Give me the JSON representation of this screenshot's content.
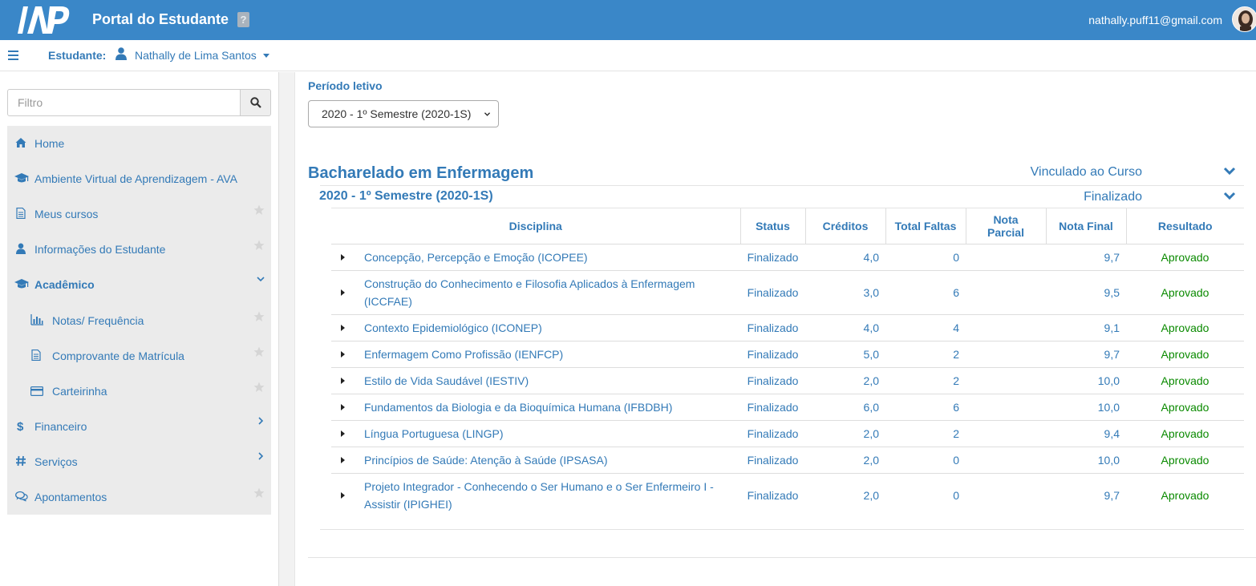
{
  "header": {
    "title": "Portal do Estudante",
    "help": "?",
    "email": "nathally.puff11@gmail.com"
  },
  "studentbar": {
    "label": "Estudante:",
    "name": "Nathally de Lima Santos"
  },
  "sidebar": {
    "filter_placeholder": "Filtro",
    "items": [
      {
        "label": "Home",
        "icon": "home-icon"
      },
      {
        "label": "Ambiente Virtual de Aprendizagem - AVA",
        "icon": "graduation-cap-icon"
      },
      {
        "label": "Meus cursos",
        "icon": "document-icon"
      },
      {
        "label": "Informações do Estudante",
        "icon": "user-icon"
      },
      {
        "label": "Acadêmico",
        "icon": "graduation-cap-icon"
      },
      {
        "label": "Notas/ Frequência",
        "icon": "bar-chart-icon"
      },
      {
        "label": "Comprovante de Matrícula",
        "icon": "document-icon"
      },
      {
        "label": "Carteirinha",
        "icon": "credit-card-icon"
      },
      {
        "label": "Financeiro",
        "icon": "dollar-icon"
      },
      {
        "label": "Serviços",
        "icon": "hash-icon"
      },
      {
        "label": "Apontamentos",
        "icon": "comments-icon"
      }
    ]
  },
  "main": {
    "periodo_label": "Período letivo",
    "periodo_selected": "2020 - 1º Semestre (2020-1S)",
    "course_title": "Bacharelado em Enfermagem",
    "course_status": "Vinculado ao Curso",
    "semester_title": "2020 - 1º Semestre (2020-1S)",
    "semester_status": "Finalizado",
    "table": {
      "headers": {
        "disciplina": "Disciplina",
        "status": "Status",
        "creditos": "Créditos",
        "faltas": "Total Faltas",
        "parcial_1": "Nota",
        "parcial_2": "Parcial",
        "final": "Nota Final",
        "resultado": "Resultado"
      },
      "rows": [
        {
          "disc1": "Concepção, Percepção e Emoção (ICOPEE)",
          "disc2": "",
          "status": "Finalizado",
          "creditos": "4,0",
          "faltas": "0",
          "parcial": "",
          "final": "9,7",
          "resultado": "Aprovado"
        },
        {
          "disc1": "Construção do Conhecimento e Filosofia Aplicados à Enfermagem",
          "disc2": "(ICCFAE)",
          "status": "Finalizado",
          "creditos": "3,0",
          "faltas": "6",
          "parcial": "",
          "final": "9,5",
          "resultado": "Aprovado"
        },
        {
          "disc1": "Contexto Epidemiológico (ICONEP)",
          "disc2": "",
          "status": "Finalizado",
          "creditos": "4,0",
          "faltas": "4",
          "parcial": "",
          "final": "9,1",
          "resultado": "Aprovado"
        },
        {
          "disc1": "Enfermagem Como Profissão (IENFCP)",
          "disc2": "",
          "status": "Finalizado",
          "creditos": "5,0",
          "faltas": "2",
          "parcial": "",
          "final": "9,7",
          "resultado": "Aprovado"
        },
        {
          "disc1": "Estilo de Vida Saudável (IESTIV)",
          "disc2": "",
          "status": "Finalizado",
          "creditos": "2,0",
          "faltas": "2",
          "parcial": "",
          "final": "10,0",
          "resultado": "Aprovado"
        },
        {
          "disc1": "Fundamentos da Biologia e da Bioquímica Humana (IFBDBH)",
          "disc2": "",
          "status": "Finalizado",
          "creditos": "6,0",
          "faltas": "6",
          "parcial": "",
          "final": "10,0",
          "resultado": "Aprovado"
        },
        {
          "disc1": "Língua Portuguesa (LINGP)",
          "disc2": "",
          "status": "Finalizado",
          "creditos": "2,0",
          "faltas": "2",
          "parcial": "",
          "final": "9,4",
          "resultado": "Aprovado"
        },
        {
          "disc1": "Princípios de Saúde: Atenção à Saúde (IPSASA)",
          "disc2": "",
          "status": "Finalizado",
          "creditos": "2,0",
          "faltas": "0",
          "parcial": "",
          "final": "10,0",
          "resultado": "Aprovado"
        },
        {
          "disc1": "Projeto Integrador - Conhecendo o Ser Humano e o Ser Enfermeiro I -",
          "disc2": "Assistir (IPIGHEI)",
          "status": "Finalizado",
          "creditos": "2,0",
          "faltas": "0",
          "parcial": "",
          "final": "9,7",
          "resultado": "Aprovado"
        }
      ]
    }
  },
  "colors": {
    "topbar": "#3a87c8",
    "link": "#337ab7",
    "approved": "#0a8a00",
    "menu_bg": "#ebebeb"
  }
}
